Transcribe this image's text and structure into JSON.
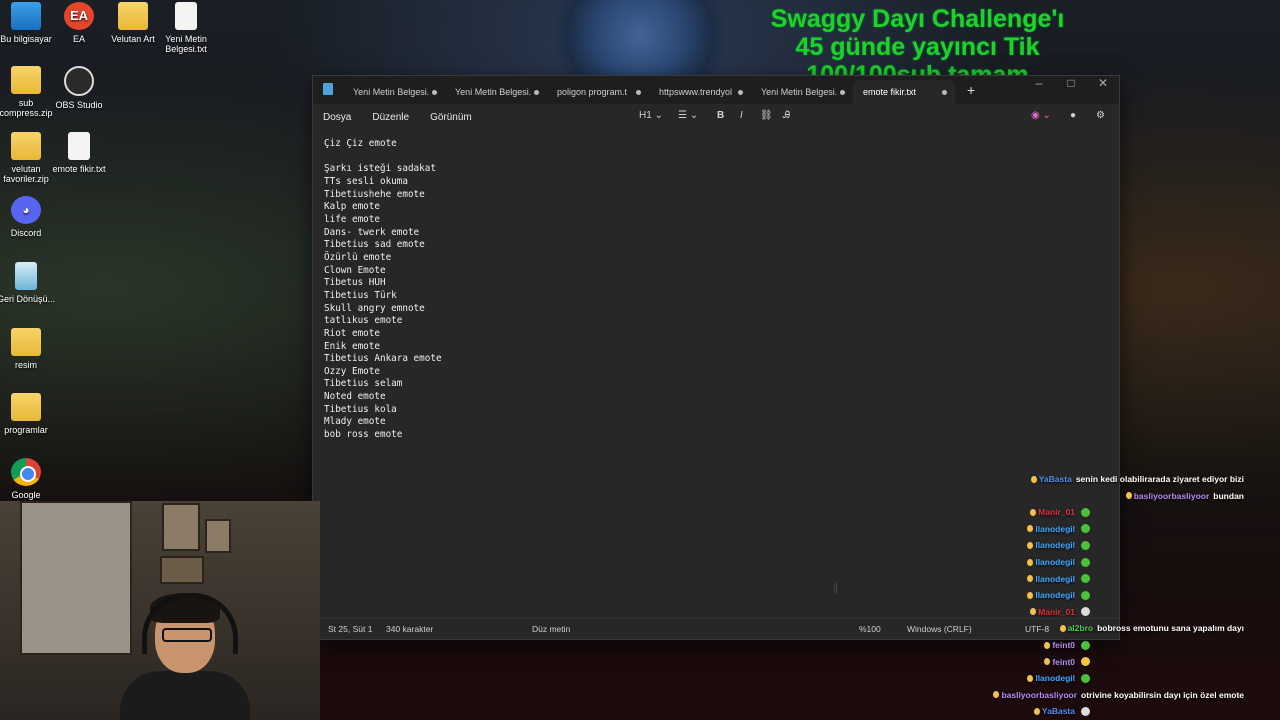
{
  "overlay": {
    "lines": [
      "Swaggy Dayı Challenge'ı",
      "45 günde yayıncı Tik",
      "100/100sub tamam"
    ]
  },
  "desktop": {
    "icons": [
      {
        "label": "Bu bilgisayar",
        "icon": "computer-icon"
      },
      {
        "label": "EA",
        "icon": "ea-icon"
      },
      {
        "label": "Velutan Art",
        "icon": "folder-icon"
      },
      {
        "label": "Yeni Metin Belgesi.txt",
        "icon": "text-file-icon"
      },
      {
        "label": "sub compress.zip",
        "icon": "zip-folder-icon"
      },
      {
        "label": "OBS Studio",
        "icon": "obs-icon"
      },
      {
        "label": "velutan favoriler.zip",
        "icon": "zip-folder-icon"
      },
      {
        "label": "emote fikir.txt",
        "icon": "text-file-icon"
      },
      {
        "label": "Discord",
        "icon": "discord-icon"
      },
      {
        "label": "Geri Dönüşü...",
        "icon": "recycle-bin-icon"
      },
      {
        "label": "resim",
        "icon": "folder-icon"
      },
      {
        "label": "programlar",
        "icon": "folder-icon"
      },
      {
        "label": "Google Chrome",
        "icon": "chrome-icon"
      }
    ]
  },
  "notepad": {
    "tabs": [
      {
        "label": "Yeni Metin Belgesi."
      },
      {
        "label": "Yeni Metin Belgesi."
      },
      {
        "label": "poligon program.t"
      },
      {
        "label": "httpswww.trendyol"
      },
      {
        "label": "Yeni Metin Belgesi."
      },
      {
        "label": "emote fikir.txt"
      }
    ],
    "add_tab": "+",
    "window_controls": {
      "minimize": "–",
      "maximize": "□",
      "close": "✕"
    },
    "menu": {
      "file": "Dosya",
      "edit": "Düzenle",
      "view": "Görünüm"
    },
    "toolbar": {
      "heading": "H1",
      "bold": "B",
      "italic": "I"
    },
    "lines": [
      "Çiz Çiz emote",
      "",
      "Şarkı isteği sadakat",
      "TTs sesli okuma",
      "Tibetiushehe emote",
      "Kalp emote",
      "life emote",
      "Dans- twerk emote",
      "Tibetius sad emote",
      "Özürlü emote",
      "Clown Emote",
      "Tibetus HUH",
      "Tibetius Türk",
      "Skull angry emnote",
      "tatlıkus emote",
      "Riot emote",
      "Enik emote",
      "Tibetius Ankara emote",
      "Ozzy Emote",
      "Tibetius selam",
      "Noted emote",
      "Tibetius kola",
      "Mlady emote",
      "bob ross emote"
    ],
    "status": {
      "position": "St 25, Süt 1",
      "chars": "340 karakter",
      "format": "Düz metin",
      "zoom": "%100",
      "line_ending": "Windows (CRLF)",
      "encoding": "UTF-8"
    }
  },
  "chat": {
    "messages": [
      {
        "user": "YaBasta",
        "text": "senin kedi olabilirarada ziyaret ediyor bizi",
        "color": "#4f8ff0"
      },
      {
        "user": "basliyoorbasliyoor",
        "text": "bundan",
        "color": "#b48df0"
      },
      {
        "user": "Manir_01",
        "text": "",
        "color": "#e0313a"
      },
      {
        "user": "llanodegil",
        "text": "",
        "color": "#3fa7ff"
      },
      {
        "user": "llanodegil",
        "text": "",
        "color": "#3fa7ff"
      },
      {
        "user": "llanodegil",
        "text": "",
        "color": "#3fa7ff"
      },
      {
        "user": "llanodegil",
        "text": "",
        "color": "#3fa7ff"
      },
      {
        "user": "llanodegil",
        "text": "",
        "color": "#3fa7ff"
      },
      {
        "user": "Manir_01",
        "text": "",
        "color": "#e0313a"
      },
      {
        "user": "al2bro",
        "text": "bobross emotunu sana yapalım dayı",
        "color": "#4ec94e"
      },
      {
        "user": "feint0",
        "text": "",
        "color": "#b48df0"
      },
      {
        "user": "feint0",
        "text": "",
        "color": "#b48df0"
      },
      {
        "user": "llanodegil",
        "text": "",
        "color": "#3fa7ff"
      },
      {
        "user": "basliyoorbasliyoor",
        "text": "otrivine koyabilirsin dayı için özel emote",
        "color": "#b48df0"
      },
      {
        "user": "YaBasta",
        "text": "",
        "color": "#4f8ff0"
      }
    ]
  }
}
